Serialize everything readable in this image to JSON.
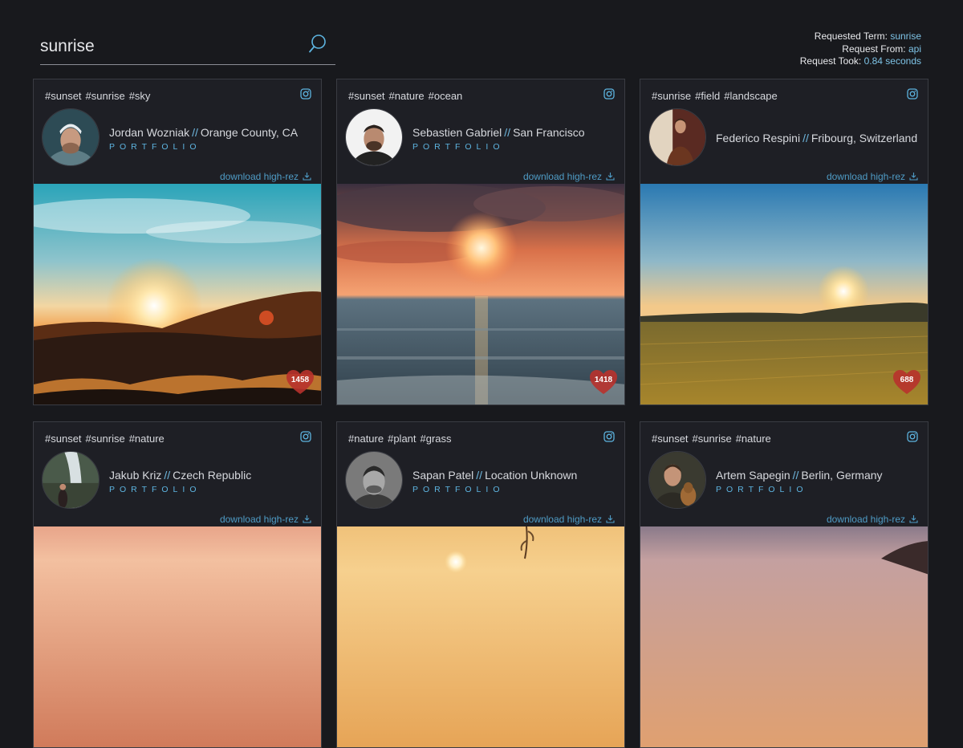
{
  "search": {
    "value": "sunrise",
    "placeholder": ""
  },
  "request_info": {
    "term_label": "Requested Term:",
    "term_value": "sunrise",
    "from_label": "Request From:",
    "from_value": "api",
    "took_label": "Request Took:",
    "took_value": "0.84 seconds"
  },
  "download_label": "download high-rez",
  "portfolio_label": "PORTFOLIO",
  "separator": "//",
  "cards": [
    {
      "tags": [
        "#sunset",
        "#sunrise",
        "#sky"
      ],
      "name": "Jordan Wozniak",
      "location": "Orange County, CA",
      "has_portfolio": true,
      "likes": "1458"
    },
    {
      "tags": [
        "#sunset",
        "#nature",
        "#ocean"
      ],
      "name": "Sebastien Gabriel",
      "location": "San Francisco",
      "has_portfolio": true,
      "likes": "1418"
    },
    {
      "tags": [
        "#sunrise",
        "#field",
        "#landscape"
      ],
      "name": "Federico Respini",
      "location": "Fribourg, Switzerland",
      "has_portfolio": false,
      "likes": "688"
    },
    {
      "tags": [
        "#sunset",
        "#sunrise",
        "#nature"
      ],
      "name": "Jakub Kriz",
      "location": "Czech Republic",
      "has_portfolio": true,
      "likes": ""
    },
    {
      "tags": [
        "#nature",
        "#plant",
        "#grass"
      ],
      "name": "Sapan Patel",
      "location": "Location Unknown",
      "has_portfolio": true,
      "likes": ""
    },
    {
      "tags": [
        "#sunset",
        "#sunrise",
        "#nature"
      ],
      "name": "Artem Sapegin",
      "location": "Berlin, Germany",
      "has_portfolio": true,
      "likes": ""
    }
  ],
  "colors": {
    "background": "#18191d",
    "card": "#1e1f25",
    "accent": "#5db4e0",
    "like": "#b8322c"
  }
}
